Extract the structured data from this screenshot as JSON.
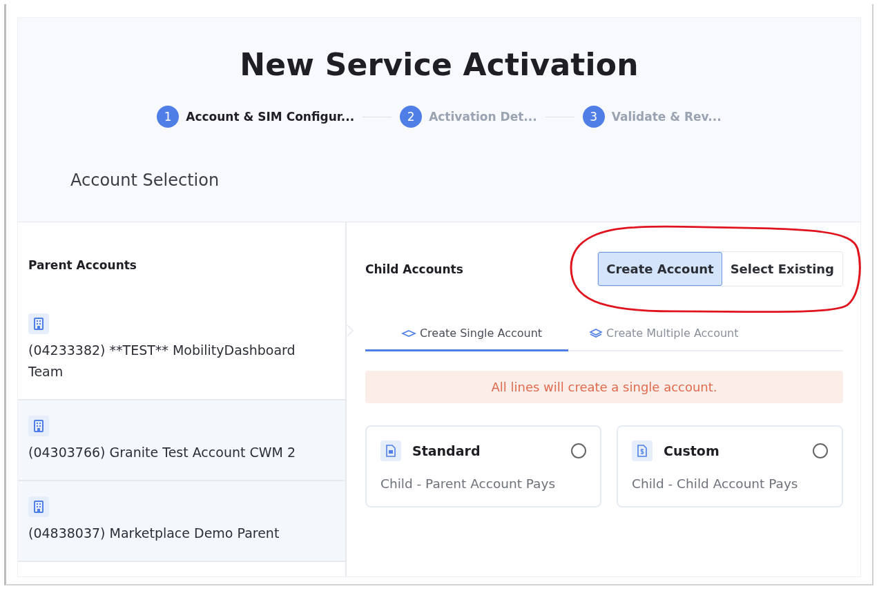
{
  "title": "New Service Activation",
  "steps": [
    {
      "number": "1",
      "label": "Account & SIM Configur...",
      "selected": true
    },
    {
      "number": "2",
      "label": "Activation Det...",
      "selected": false
    },
    {
      "number": "3",
      "label": "Validate & Rev...",
      "selected": false
    }
  ],
  "section_title": "Account Selection",
  "parent_accounts": {
    "heading": "Parent Accounts",
    "items": [
      {
        "label": "(04233382) **TEST** MobilityDashboard Team",
        "selected": true
      },
      {
        "label": "(04303766) Granite Test Account CWM 2",
        "selected": false
      },
      {
        "label": "(04838037) Marketplace Demo Parent",
        "selected": false
      }
    ]
  },
  "child_accounts": {
    "heading": "Child Accounts",
    "mode_buttons": [
      {
        "label": "Create Account",
        "selected": true
      },
      {
        "label": "Select Existing",
        "selected": false
      }
    ],
    "tabs": [
      {
        "label": "Create Single Account",
        "kind": "single",
        "selected": true
      },
      {
        "label": "Create Multiple Account",
        "kind": "multiple",
        "selected": false
      }
    ],
    "notice": "All lines will create a single account.",
    "options": [
      {
        "title": "Standard",
        "description": "Child - Parent Account Pays",
        "kind": "standard",
        "selected": false
      },
      {
        "title": "Custom",
        "description": "Child - Child Account Pays",
        "kind": "custom",
        "selected": false
      }
    ]
  }
}
